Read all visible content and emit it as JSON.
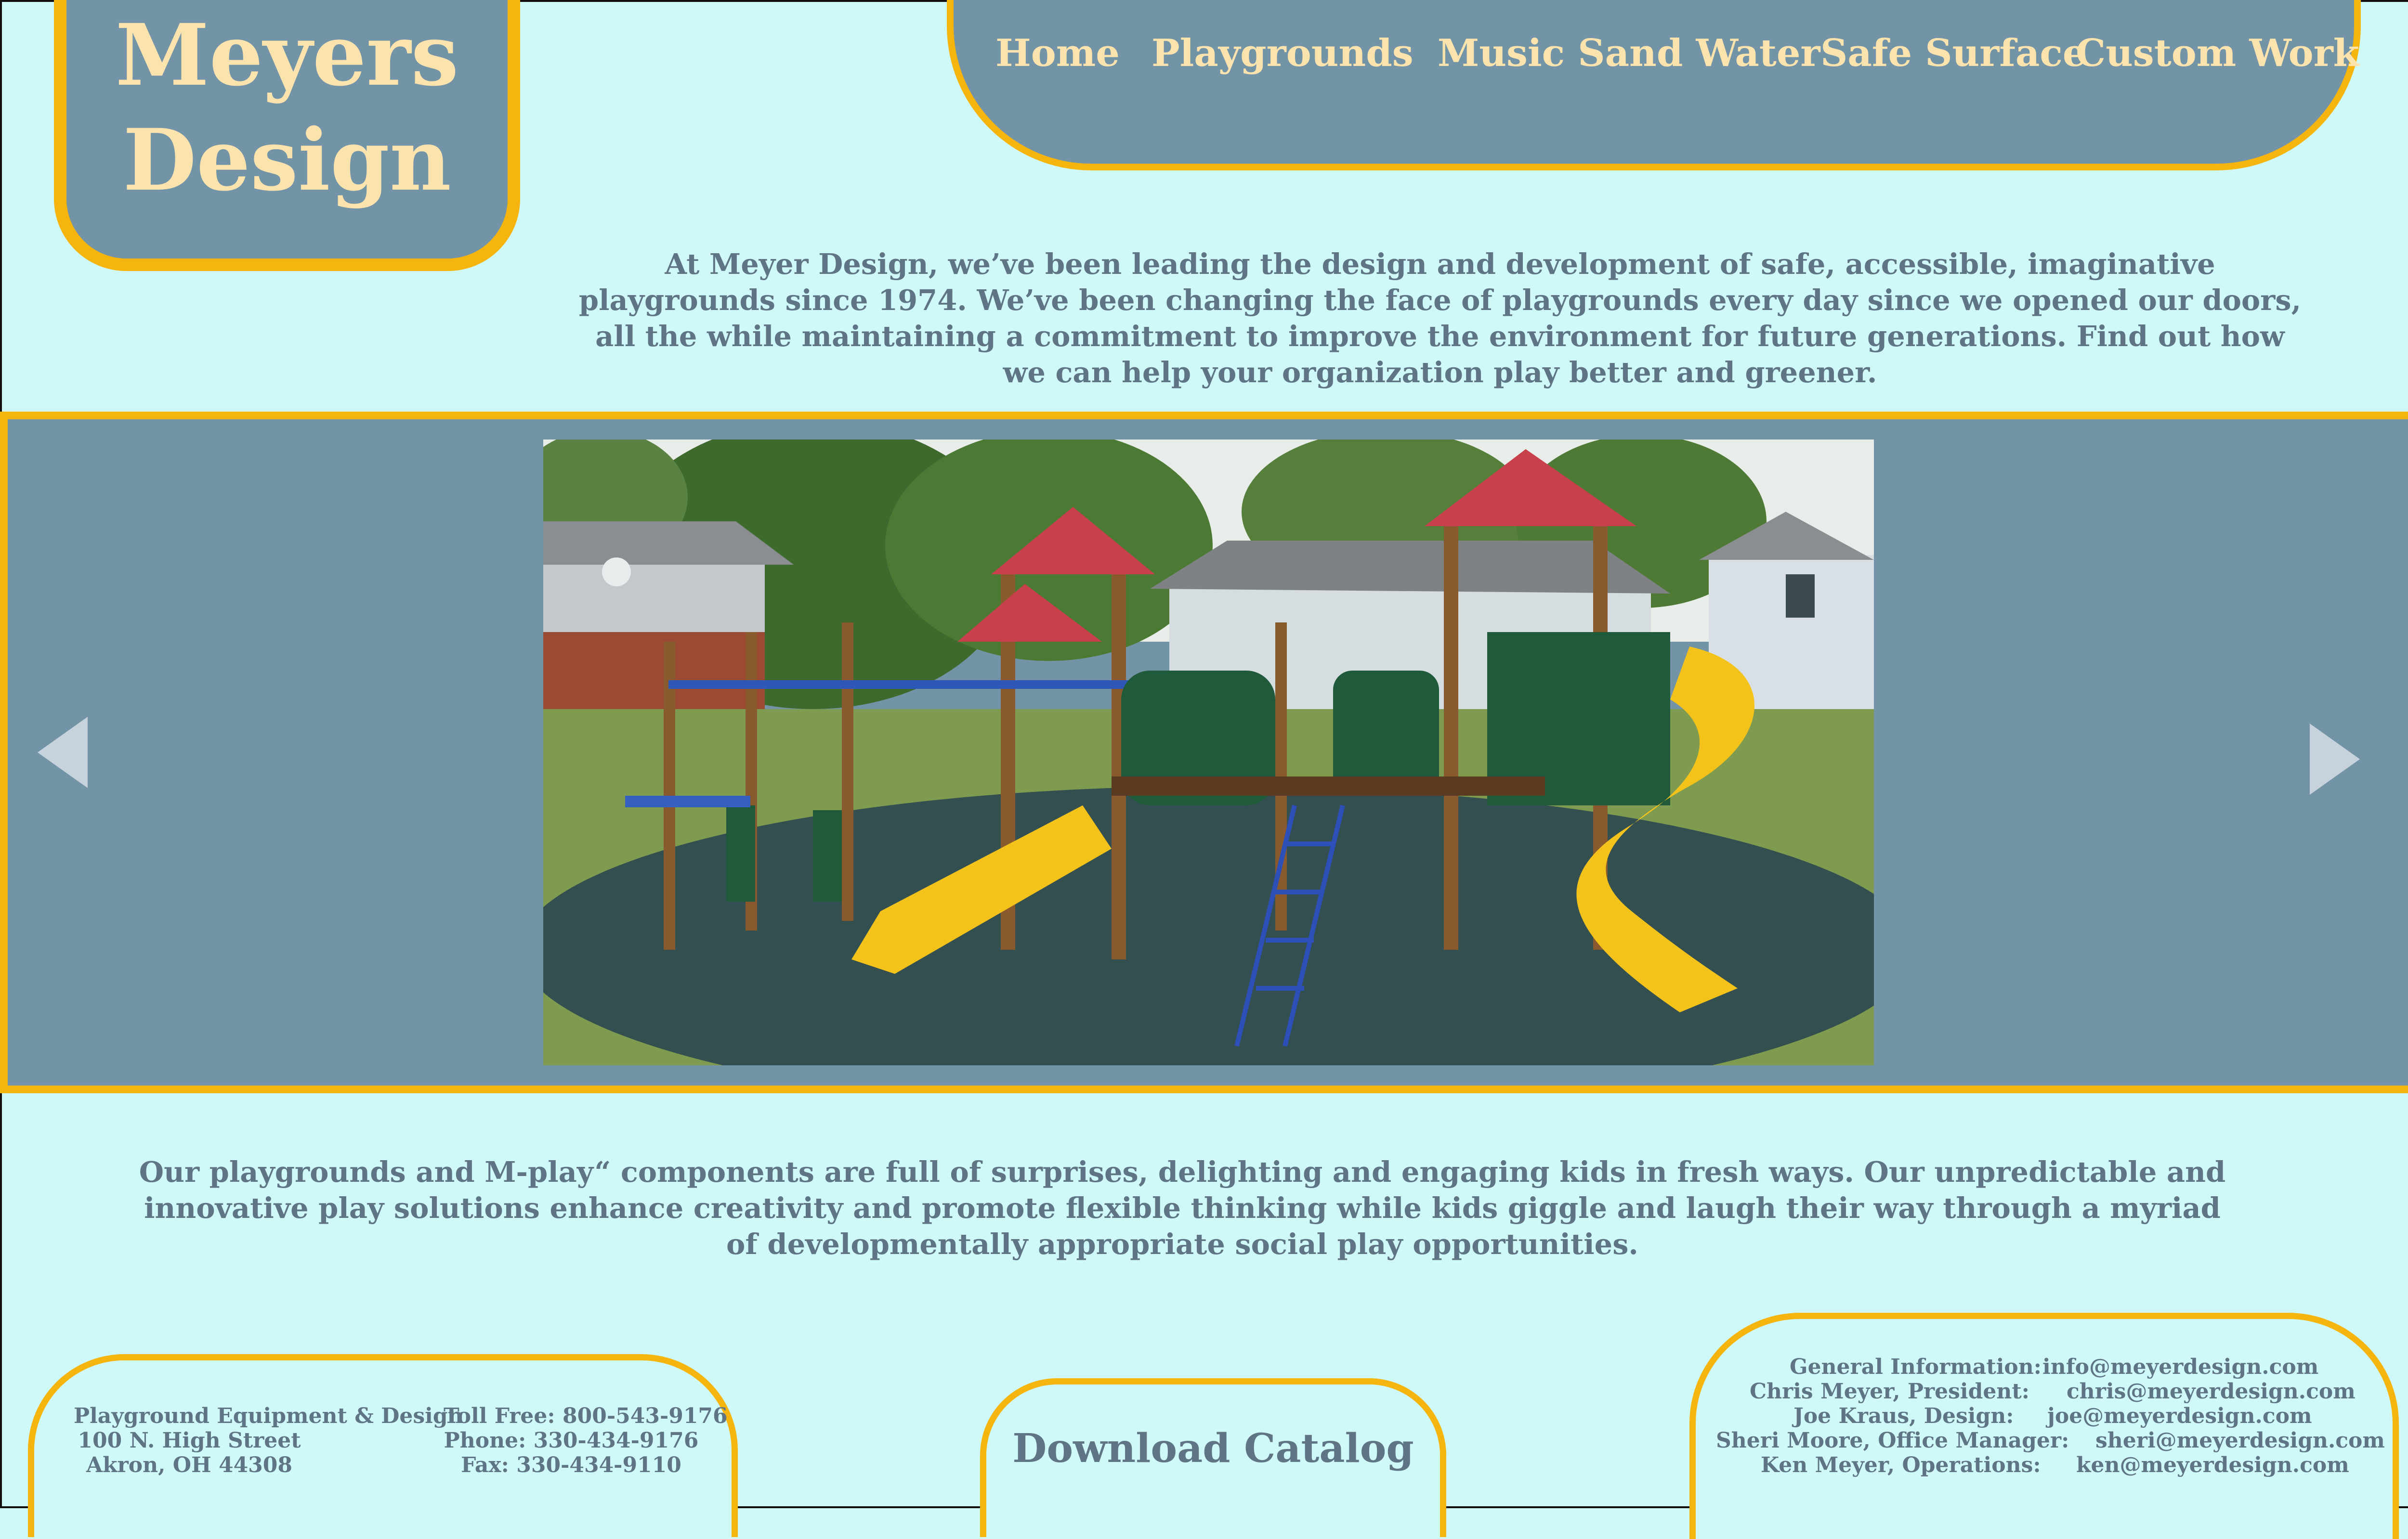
{
  "brand": {
    "line1": "Meyers",
    "line2": "Design"
  },
  "nav": [
    "Home",
    "Playgrounds",
    "Music Sand Water",
    "Safe Surface",
    "Custom Work"
  ],
  "intro": "At Meyer Design, we’ve been leading the design and development of safe, accessible, imaginative playgrounds since 1974. We’ve been changing the face of playgrounds every day since we opened our doors, all the while maintaining a commitment to improve the environment for future generations. Find out how we can help your organization play better and greener.",
  "body": "Our playgrounds and M-play“ components are full of surprises, delighting and engaging kids in fresh ways. Our unpredictable and innovative play solutions enhance creativity and promote flexible thinking while kids giggle and laugh their way through a myriad of developmentally appropriate social play opportunities.",
  "address": {
    "company": "Playground Equipment & Design",
    "street": "100 N. High Street",
    "city": "Akron, OH 44308",
    "toll_free": "Toll Free: 800-543-9176",
    "phone": "Phone: 330-434-9176",
    "fax": "Fax: 330-434-9110"
  },
  "catalog_label": "Download Catalog",
  "contacts": [
    {
      "label": "General Information:",
      "email": "info@meyerdesign.com"
    },
    {
      "label": "Chris Meyer, President:",
      "email": "chris@meyerdesign.com"
    },
    {
      "label": "Joe Kraus, Design:",
      "email": "joe@meyerdesign.com"
    },
    {
      "label": "Sheri Moore, Office Manager:",
      "email": "sheri@meyerdesign.com"
    },
    {
      "label": "Ken Meyer, Operations:",
      "email": "ken@meyerdesign.com"
    }
  ],
  "colors": {
    "background": "#cff9f8",
    "slate": "#7393a7",
    "gold": "#f6b40f",
    "logo_text": "#fbe3ad",
    "body_text": "#5f7585"
  },
  "icons": [
    "chevron-left-icon",
    "chevron-right-icon"
  ]
}
